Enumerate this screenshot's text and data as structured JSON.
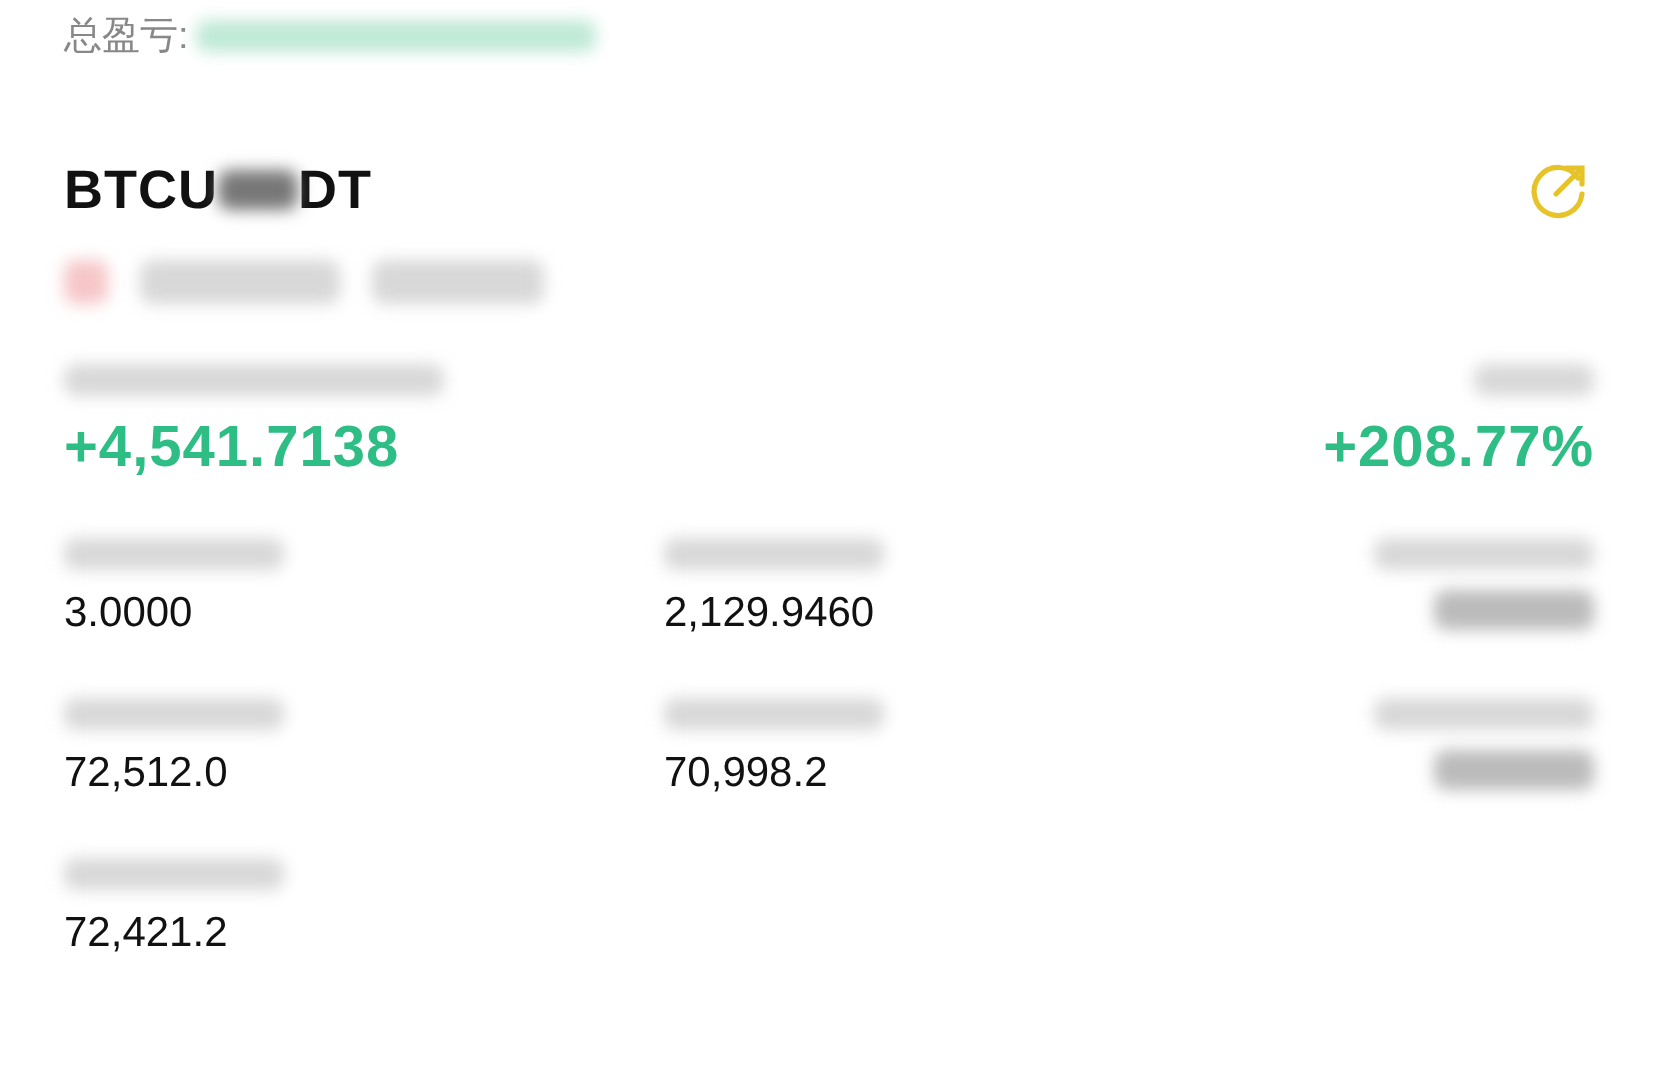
{
  "header": {
    "label": "总盈亏:"
  },
  "symbol": {
    "title_start": "BTCU",
    "title_end": "DT"
  },
  "pnl": {
    "value": "+4,541.7138",
    "ratio": "+208.77%"
  },
  "stats": [
    {
      "kind": "value",
      "value": "3.0000"
    },
    {
      "kind": "value",
      "value": "2,129.9460"
    },
    {
      "kind": "redacted"
    },
    {
      "kind": "value",
      "value": "72,512.0"
    },
    {
      "kind": "value",
      "value": "70,998.2"
    },
    {
      "kind": "redacted"
    },
    {
      "kind": "value",
      "value": "72,421.2"
    }
  ]
}
